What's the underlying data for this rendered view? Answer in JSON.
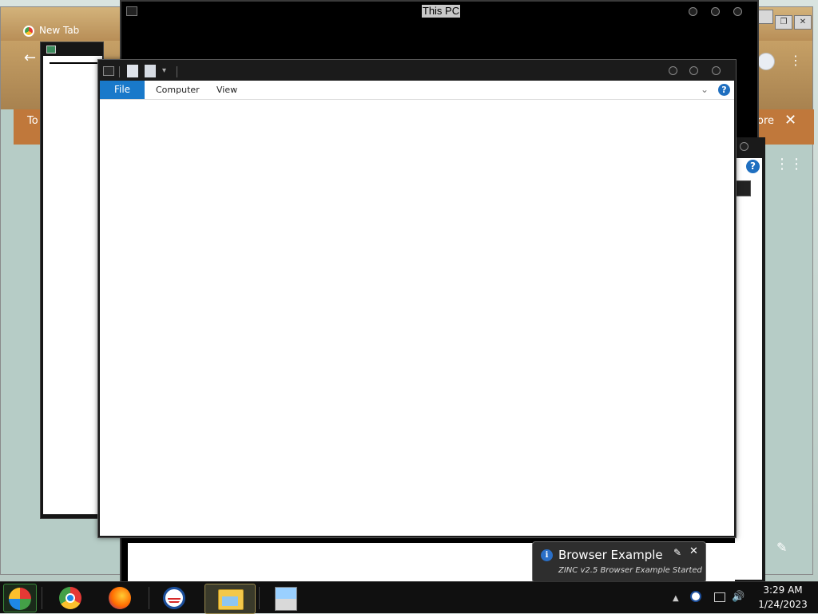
{
  "background_browser": {
    "tab_title": "New Tab",
    "banner_left": "To",
    "banner_right": "ore",
    "banner_close": "✕",
    "back_glyph": "←",
    "menu_glyph": "⋮",
    "apps_glyph": "⋮⋮",
    "edit_glyph": "✎",
    "min_glyph": "",
    "restore_glyph": "❐",
    "close_glyph": "✕"
  },
  "thispc_window": {
    "title": "This PC"
  },
  "explorer_window": {
    "qa_dropdown": "▾",
    "tabs": [
      {
        "label": "File"
      },
      {
        "label": "Computer"
      },
      {
        "label": "View"
      }
    ],
    "expand_glyph": "⌄",
    "help_glyph": "?"
  },
  "right_window": {
    "help_glyph": "?"
  },
  "notification": {
    "title": "Browser Example",
    "body": "ZINC v2.5 Browser Example Started",
    "info_glyph": "i",
    "pin_glyph": "✎",
    "close_glyph": "✕"
  },
  "taskbar": {
    "apps": [
      {
        "name": "Google Chrome"
      },
      {
        "name": "Firefox"
      },
      {
        "name": "ZINC"
      },
      {
        "name": "File Explorer"
      },
      {
        "name": "Installer"
      }
    ],
    "tray_arrow": "▲",
    "volume_glyph": "🔊",
    "clock_time": "3:29 AM",
    "clock_date": "1/24/2023"
  },
  "colors": {
    "accent": "#1979ca",
    "taskbar": "#101010",
    "window_frame": "#1b1b1b",
    "banner": "#c0783b"
  }
}
